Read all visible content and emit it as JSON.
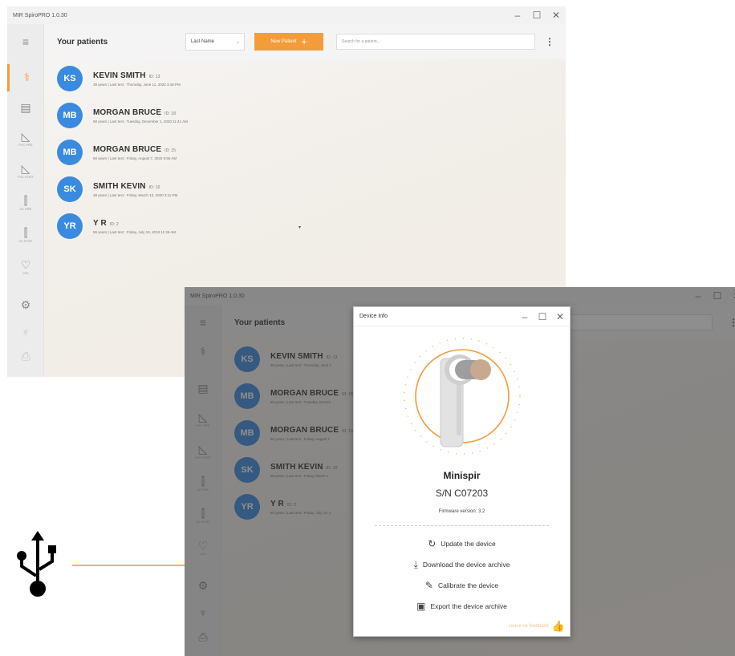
{
  "app": {
    "title": "MIR SpiroPRO 1.0.30",
    "controls": {
      "minimize": "–",
      "maximize": "☐",
      "close": "✕"
    }
  },
  "sidebar": {
    "items": [
      {
        "icon": "menu-icon",
        "glyph": "≡",
        "caption": ""
      },
      {
        "icon": "patients-icon",
        "glyph": "⚕",
        "caption": ""
      },
      {
        "icon": "clipboard-icon",
        "glyph": "▤",
        "caption": ""
      },
      {
        "icon": "fvc-pre-icon",
        "glyph": "◺",
        "caption": "FVC PRE"
      },
      {
        "icon": "fvc-post-icon",
        "glyph": "◺",
        "caption": "FVC POST"
      },
      {
        "icon": "vc-pre-icon",
        "glyph": "⫿",
        "caption": "VC PRE"
      },
      {
        "icon": "vc-post-icon",
        "glyph": "⫿",
        "caption": "VC POST"
      },
      {
        "icon": "heart-icon",
        "glyph": "♡",
        "caption": "OXI"
      },
      {
        "icon": "settings-icon",
        "glyph": "⚙",
        "caption": ""
      },
      {
        "icon": "device-icon",
        "glyph": "♆",
        "caption": ""
      },
      {
        "icon": "printer-icon",
        "glyph": "⎙",
        "caption": ""
      }
    ]
  },
  "header": {
    "title": "Your patients",
    "sort_value": "Last Name",
    "new_patient_label": "New Patient",
    "search_placeholder": "Search for a patient...",
    "menu_glyph": "⋮"
  },
  "patients": [
    {
      "initials": "KS",
      "name": "KEVIN SMITH",
      "id": "ID: 13",
      "meta": "38 years  |  Last test : Thursday, June 11, 2020 3:18 PM"
    },
    {
      "initials": "MB",
      "name": "MORGAN BRUCE",
      "id": "ID: 18",
      "meta": "59 years  |  Last test : Tuesday, December 1, 2020 11:41 AM"
    },
    {
      "initials": "MB",
      "name": "MORGAN BRUCE",
      "id": "ID: 15",
      "meta": "60 years  |  Last test : Friday, August 7, 2020 9:55 AM"
    },
    {
      "initials": "SK",
      "name": "SMITH KEVIN",
      "id": "ID: 10",
      "meta": "38 years  |  Last test : Friday, March 13, 2020 2:11 PM"
    },
    {
      "initials": "YR",
      "name": "Y R",
      "id": "ID: 2",
      "meta": "59 years  |  Last test : Friday, July 19, 2019 11:36 AM"
    }
  ],
  "patients_bg": [
    {
      "meta": "38 years  |  Last test : Thursday, June 1"
    },
    {
      "meta": "59 years  |  Last test : Tuesday, Decem"
    },
    {
      "meta": "60 years  |  Last test : Friday, August 7"
    },
    {
      "meta": "38 years  |  Last test : Friday, March 1"
    },
    {
      "meta": "59 years  |  Last test : Friday, July 19, 2"
    }
  ],
  "device_dialog": {
    "title": "Device Info",
    "device_name": "Minispir",
    "serial": "S/N C07203",
    "firmware": "Firmware version: 3.2",
    "actions": [
      {
        "icon": "refresh-icon",
        "glyph": "↻",
        "label": "Update the device"
      },
      {
        "icon": "download-icon",
        "glyph": "⤓",
        "label": "Download the device archive"
      },
      {
        "icon": "wrench-icon",
        "glyph": "✎",
        "label": "Calibrate the device"
      },
      {
        "icon": "save-icon",
        "glyph": "▣",
        "label": "Export the device archive"
      }
    ],
    "feedback_label": "Leave us feedback"
  },
  "colors": {
    "accent": "#f39c3b",
    "avatar": "#3a8be0"
  }
}
